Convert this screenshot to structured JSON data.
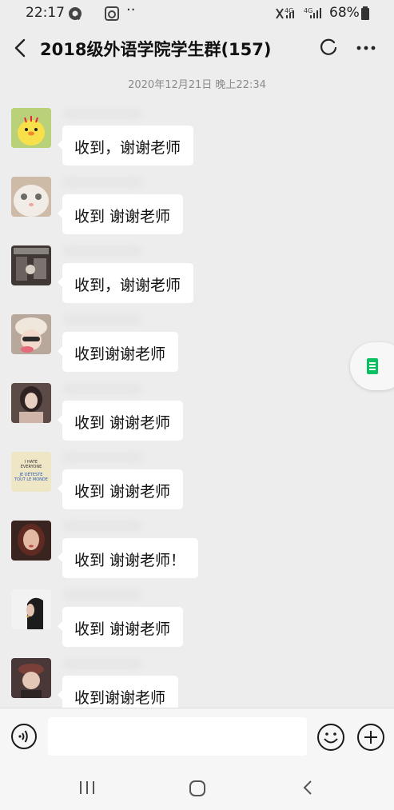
{
  "status_bar": {
    "time": "22:17",
    "network": "4G",
    "battery": "68%"
  },
  "header": {
    "title": "2018级外语学院学生群(157)"
  },
  "chat": {
    "timestamp": "2020年12月21日 晚上22:34",
    "messages": [
      {
        "text": "收到，谢谢老师",
        "avatar_color": "#e9d94a"
      },
      {
        "text": "收到 谢谢老师",
        "avatar_color": "#d9c9b8"
      },
      {
        "text": "收到，谢谢老师",
        "avatar_color": "#5a4b42"
      },
      {
        "text": "收到谢谢老师",
        "avatar_color": "#d8c0b0"
      },
      {
        "text": "收到 谢谢老师",
        "avatar_color": "#4a3a36"
      },
      {
        "text": "收到 谢谢老师",
        "avatar_color": "#efe6c6"
      },
      {
        "text": "收到 谢谢老师！",
        "avatar_color": "#7a4a3a"
      },
      {
        "text": "收到 谢谢老师",
        "avatar_color": "#eeeeee"
      },
      {
        "text": "收到谢谢老师",
        "avatar_color": "#5b3a36"
      }
    ],
    "avatar_6_lines": [
      "I HATE",
      "EVERYONE",
      "JE DÉTESTE",
      "TOUT LE MONDE"
    ]
  },
  "colors": {
    "background": "#ededed",
    "bubble": "#ffffff",
    "accent_green": "#07c160"
  },
  "icons": [
    "back-icon",
    "refresh-icon",
    "more-icon",
    "voice-icon",
    "emoji-icon",
    "plus-icon",
    "document-icon"
  ]
}
